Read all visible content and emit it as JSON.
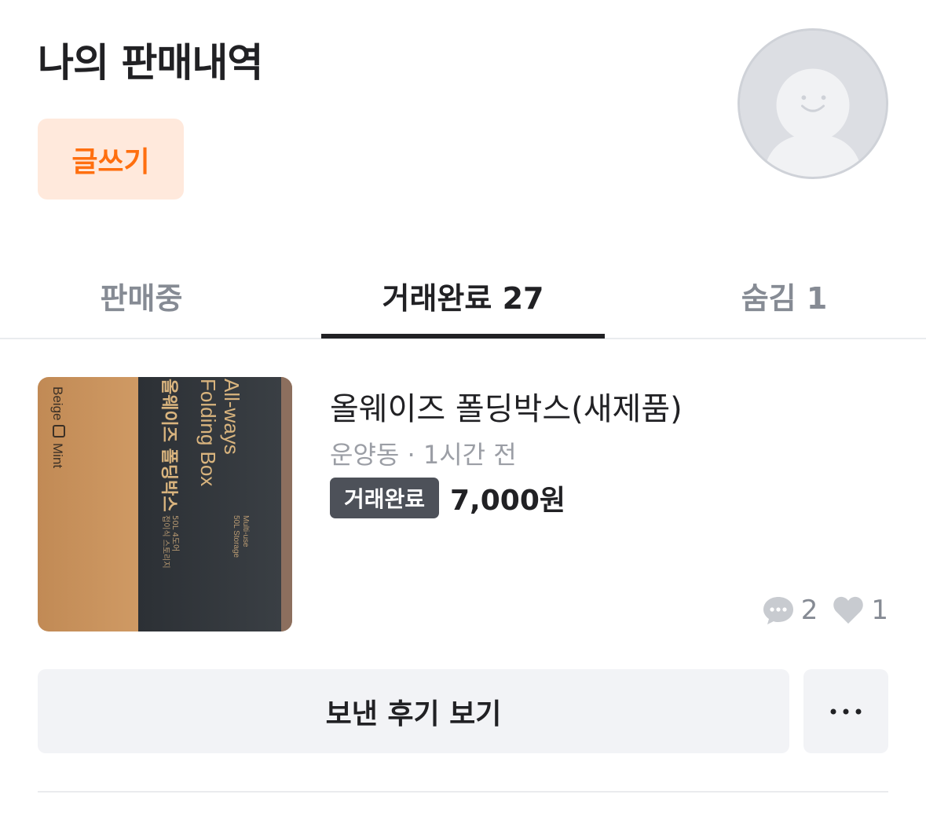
{
  "header": {
    "title": "나의 판매내역",
    "write_label": "글쓰기"
  },
  "profile": {
    "avatar_icon": "default-avatar-icon"
  },
  "tabs": [
    {
      "label": "판매중",
      "active": false
    },
    {
      "label": "거래완료 27",
      "active": true
    },
    {
      "label": "숨김 1",
      "active": false
    }
  ],
  "item": {
    "title": "올웨이즈 폴딩박스(새제품)",
    "meta": "운양동 · 1시간 전",
    "status": "거래완료",
    "price": "7,000원",
    "chat_count": "2",
    "like_count": "1",
    "image_text": {
      "color_left_1": "Beige",
      "color_left_2": "Mint",
      "brand_en_1": "All-ways",
      "brand_en_2": "Folding Box",
      "brand_ko": "올웨이즈 폴딩박스",
      "spec_en_1": "Multi-use",
      "spec_en_2": "50L Storage",
      "spec_ko_1": "50L 4도어",
      "spec_ko_2": "접이식 스토리지"
    }
  },
  "actions": {
    "review_label": "보낸 후기 보기",
    "more_icon": "more-horizontal-icon"
  },
  "colors": {
    "accent": "#ff6f0f",
    "accent_bg": "#ffe9dc",
    "text": "#212124",
    "muted": "#868b94",
    "badge_bg": "#4d5159",
    "button_bg": "#f2f3f6"
  }
}
